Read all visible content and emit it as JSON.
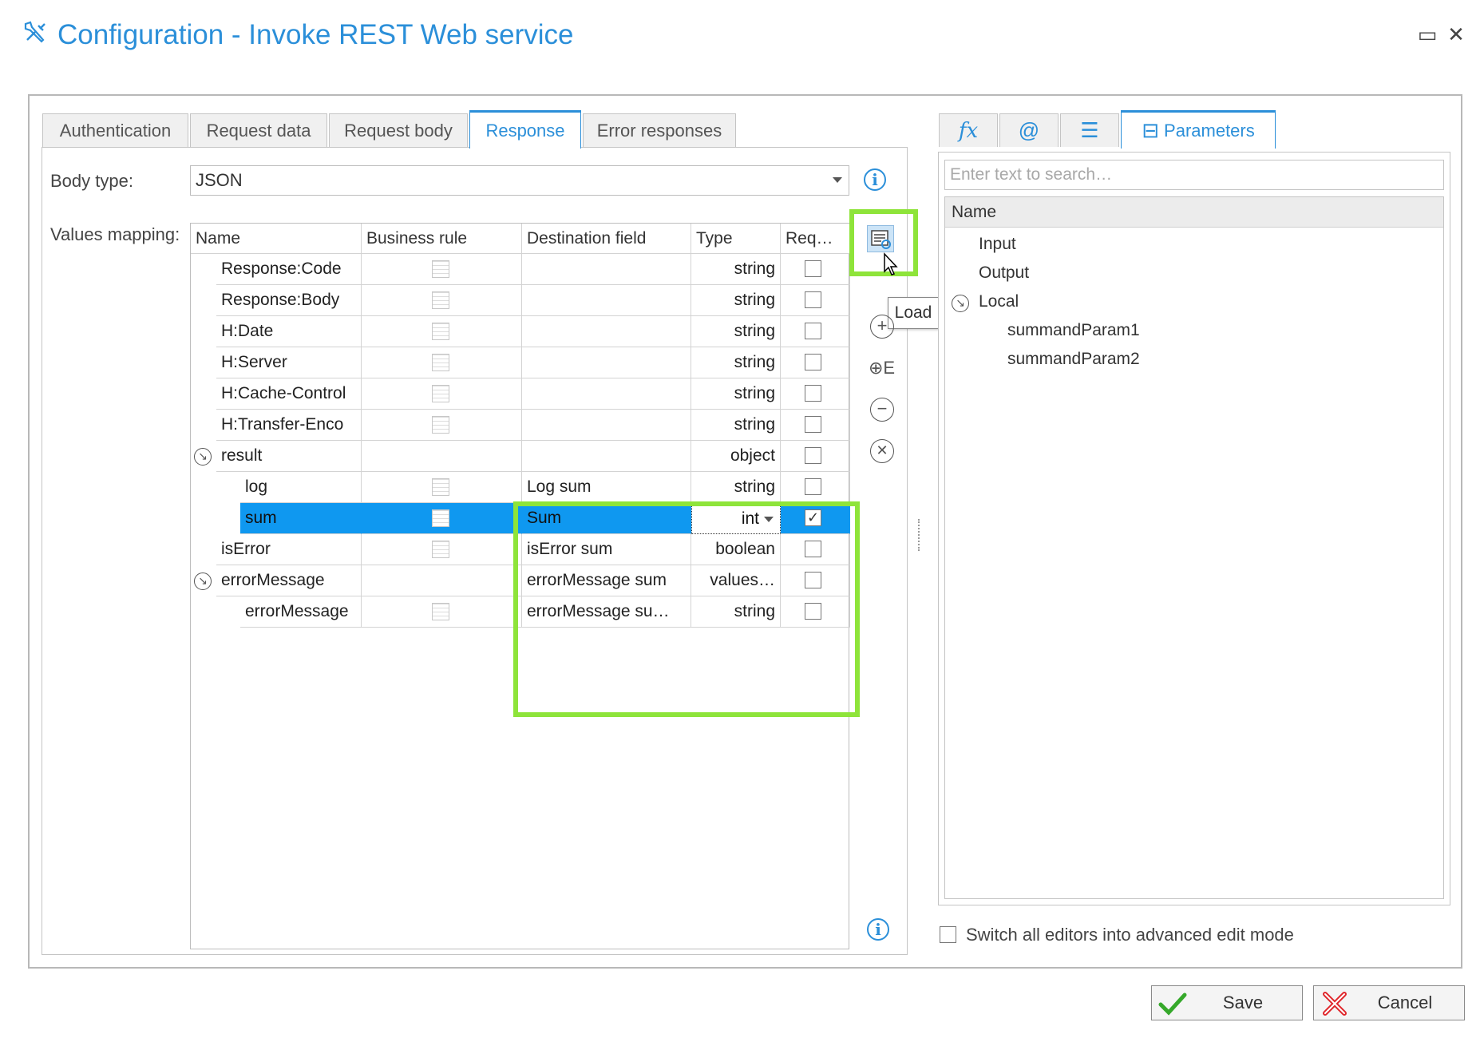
{
  "window": {
    "title": "Configuration - Invoke REST Web service",
    "maximize_glyph": "▭",
    "close_glyph": "✕"
  },
  "tabs": [
    {
      "label": "Authentication",
      "active": false
    },
    {
      "label": "Request data",
      "active": false
    },
    {
      "label": "Request body",
      "active": false
    },
    {
      "label": "Response",
      "active": true
    },
    {
      "label": "Error responses",
      "active": false
    }
  ],
  "response": {
    "body_type_label": "Body type:",
    "body_type_value": "JSON",
    "values_mapping_label": "Values mapping:",
    "columns": [
      "Name",
      "Business rule",
      "Destination field",
      "Type",
      "Req…"
    ],
    "rows": [
      {
        "name": "Response:Code",
        "level": 1,
        "expander": false,
        "business_rule": true,
        "destination": "",
        "type": "string",
        "required": false,
        "selected": false
      },
      {
        "name": "Response:Body",
        "level": 1,
        "expander": false,
        "business_rule": true,
        "destination": "",
        "type": "string",
        "required": false,
        "selected": false
      },
      {
        "name": "H:Date",
        "level": 1,
        "expander": false,
        "business_rule": true,
        "destination": "",
        "type": "string",
        "required": false,
        "selected": false
      },
      {
        "name": "H:Server",
        "level": 1,
        "expander": false,
        "business_rule": true,
        "destination": "",
        "type": "string",
        "required": false,
        "selected": false
      },
      {
        "name": "H:Cache-Control",
        "level": 1,
        "expander": false,
        "business_rule": true,
        "destination": "",
        "type": "string",
        "required": false,
        "selected": false
      },
      {
        "name": "H:Transfer-Enco",
        "level": 1,
        "expander": false,
        "business_rule": true,
        "destination": "",
        "type": "string",
        "required": false,
        "selected": false
      },
      {
        "name": "result",
        "level": 1,
        "expander": true,
        "business_rule": false,
        "destination": "",
        "type": "object",
        "required": false,
        "selected": false
      },
      {
        "name": "log",
        "level": 2,
        "expander": false,
        "business_rule": true,
        "destination": "Log sum",
        "type": "string",
        "required": false,
        "selected": false
      },
      {
        "name": "sum",
        "level": 2,
        "expander": false,
        "business_rule": true,
        "destination": "Sum",
        "type": "int",
        "required": true,
        "selected": true
      },
      {
        "name": "isError",
        "level": 1,
        "expander": false,
        "business_rule": true,
        "destination": "isError sum",
        "type": "boolean",
        "required": false,
        "selected": false
      },
      {
        "name": "errorMessage",
        "level": 1,
        "expander": true,
        "business_rule": false,
        "destination": "errorMessage sum",
        "type": "values…",
        "required": false,
        "selected": false
      },
      {
        "name": "errorMessage",
        "level": 2,
        "expander": false,
        "business_rule": true,
        "destination": "errorMessage su…",
        "type": "string",
        "required": false,
        "selected": false
      }
    ],
    "tooltip_load": "Load",
    "check_glyph": "✓"
  },
  "right_panel": {
    "tabs": [
      {
        "icon": "function-icon",
        "glyph": "𝑓x",
        "label": ""
      },
      {
        "icon": "at-sign-icon",
        "glyph": "@",
        "label": ""
      },
      {
        "icon": "list-icon",
        "glyph": "☰",
        "label": ""
      },
      {
        "icon": "parameters-icon",
        "glyph": "⊟",
        "label": "Parameters"
      }
    ],
    "search_placeholder": "Enter text to search…",
    "tree_header": "Name",
    "tree": [
      {
        "label": "Input",
        "level": 0,
        "expander": false
      },
      {
        "label": "Output",
        "level": 0,
        "expander": false
      },
      {
        "label": "Local",
        "level": 0,
        "expander": true
      },
      {
        "label": "summandParam1",
        "level": 1,
        "expander": false
      },
      {
        "label": "summandParam2",
        "level": 1,
        "expander": false
      }
    ],
    "advanced_mode_label": "Switch all editors into advanced edit mode",
    "advanced_mode_checked": false
  },
  "footer": {
    "save_label": "Save",
    "cancel_label": "Cancel"
  },
  "colors": {
    "accent": "#2b8fd9",
    "selection": "#0f98f0",
    "highlight_green": "#8ee43a",
    "cancel_red": "#e0262b",
    "save_green": "#35a82a"
  }
}
